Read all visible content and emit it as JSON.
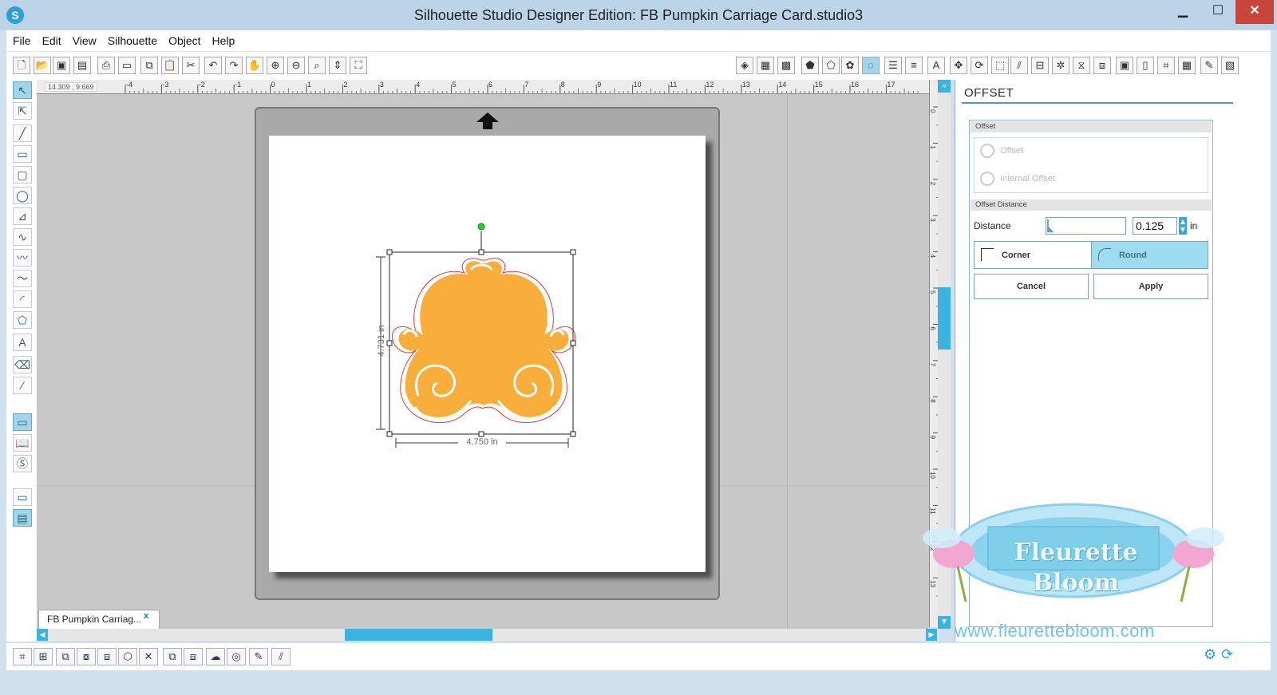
{
  "window": {
    "title": "Silhouette Studio Designer Edition: FB Pumpkin Carriage Card.studio3",
    "min_icon": "minimize-icon",
    "max_icon": "maximize-icon",
    "close_icon": "close-icon"
  },
  "menu": [
    "File",
    "Edit",
    "View",
    "Silhouette",
    "Object",
    "Help"
  ],
  "ruler": {
    "coords": "14.309 , 9.669",
    "h_ticks": [
      "-4",
      "-3",
      "-2",
      "-1",
      "0",
      "1",
      "2",
      "3",
      "4",
      "5",
      "6",
      "7",
      "8",
      "9",
      "10",
      "11",
      "12",
      "13",
      "14",
      "15",
      "16",
      "17"
    ],
    "v_ticks": [
      "0",
      "1",
      "2",
      "3",
      "4",
      "5",
      "6",
      "7",
      "8",
      "9",
      "10",
      "11",
      "12",
      "13"
    ]
  },
  "design": {
    "height_label": "4.731 in",
    "width_label": "4.750 in",
    "fill_color": "#f9ae3b",
    "cut_color": "#e23a3a"
  },
  "doc_tab": {
    "label": "FB Pumpkin Carriag...",
    "close": "x"
  },
  "panel": {
    "title": "OFFSET",
    "section_offset": "Offset",
    "opt_offset": "Offset",
    "opt_internal": "Internal Offset",
    "section_distance": "Offset Distance",
    "distance_label": "Distance",
    "distance_value": "0.125",
    "distance_unit": "in",
    "corner_label": "Corner",
    "round_label": "Round",
    "cancel_label": "Cancel",
    "apply_label": "Apply"
  },
  "watermark": {
    "name": "Fleurette Bloom",
    "url": "www.fleurettebloom.com"
  },
  "colors": {
    "accent": "#3bb3e0",
    "selected": "#9edcf0"
  }
}
